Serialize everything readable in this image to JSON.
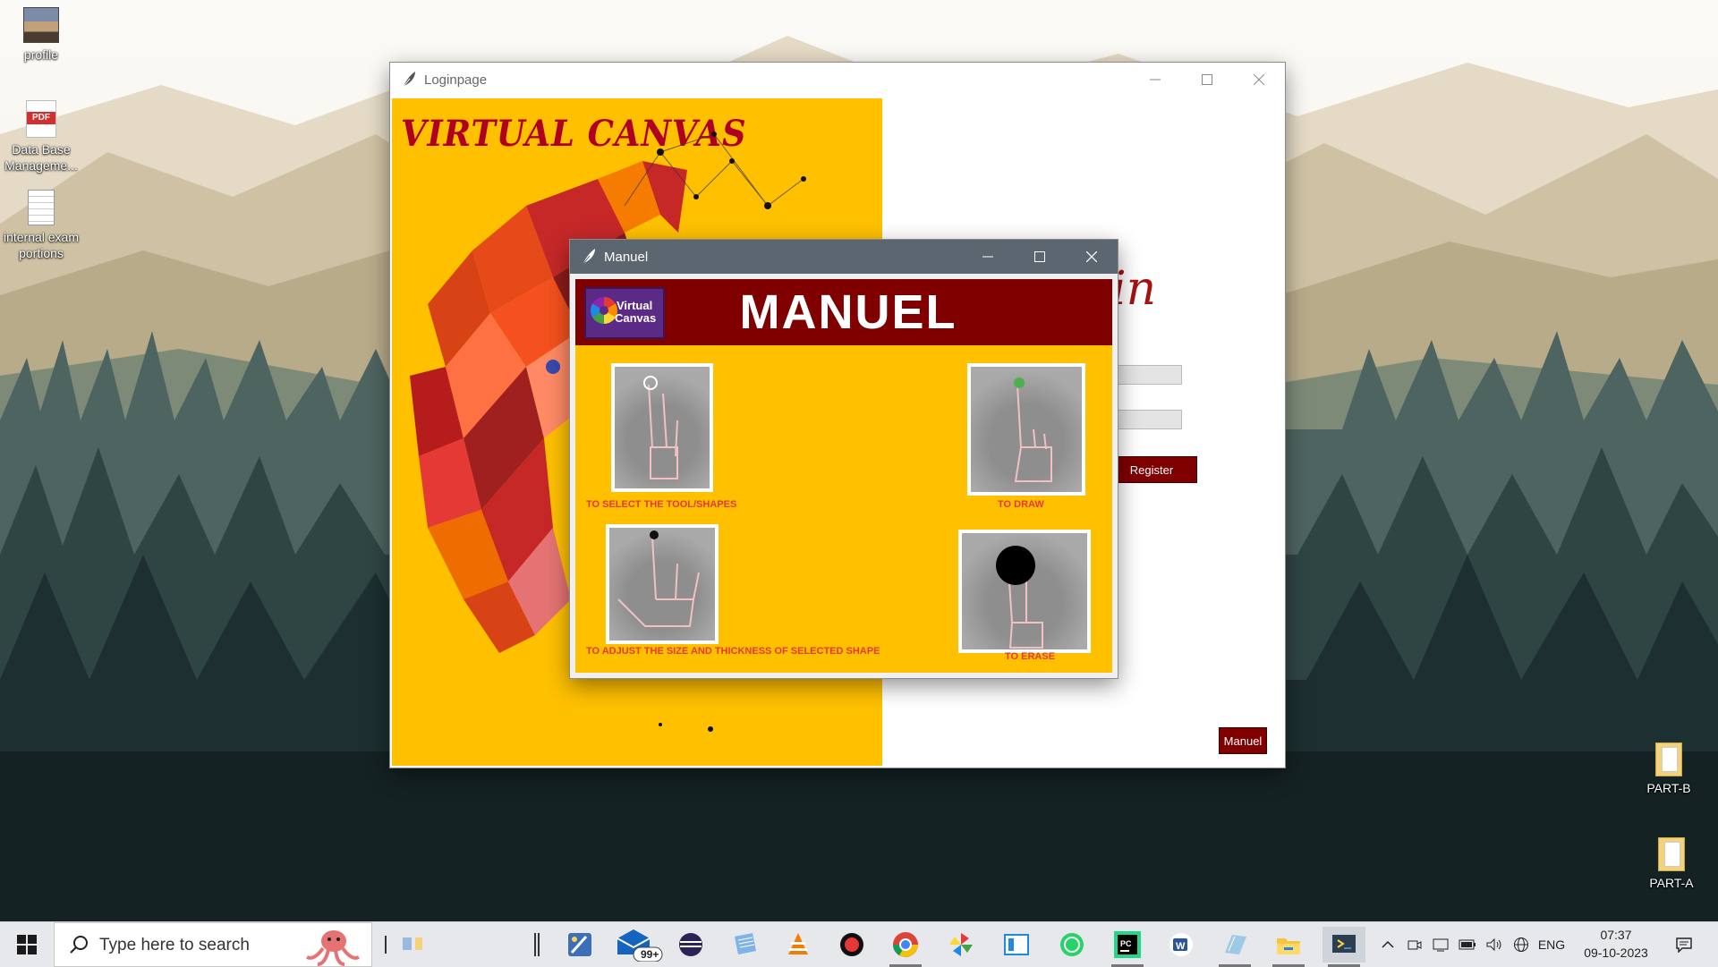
{
  "desktop": {
    "icons": [
      {
        "label": "profile"
      },
      {
        "label": "Data Base Manageme...",
        "badge": "PDF"
      },
      {
        "label": "internal exam portions"
      },
      {
        "label": "PART-B"
      },
      {
        "label": "PART-A"
      }
    ]
  },
  "login_window": {
    "title": "Loginpage",
    "brand": "VIRTUAL CANVAS",
    "heading_visible": "in",
    "register_label": "Register",
    "manuel_label": "Manuel"
  },
  "manuel_window": {
    "title": "Manuel",
    "header": "MANUEL",
    "logo_line1": "Virtual",
    "logo_line2": "Canvas",
    "gestures": [
      {
        "caption": "TO SELECT THE TOOL/SHAPES"
      },
      {
        "caption": "TO DRAW"
      },
      {
        "caption": "TO ADJUST THE SIZE AND THICKNESS OF SELECTED SHAPE"
      },
      {
        "caption": "TO ERASE"
      }
    ],
    "colors": {
      "header_bg": "#800000",
      "body_bg": "#ffc000",
      "caption": "#e53935"
    }
  },
  "taskbar": {
    "search_placeholder": "Type here to search",
    "mail_badge": "99+",
    "language": "ENG",
    "time": "07:37",
    "date": "09-10-2023",
    "apps": [
      "paint-app-icon",
      "mail-app-icon",
      "eclipse-app-icon",
      "notepad-app-icon",
      "vlc-app-icon",
      "record-app-icon",
      "chrome-app-icon",
      "pinwheel-app-icon",
      "screen-app-icon",
      "whatsapp-app-icon",
      "pycharm-app-icon",
      "word-app-icon",
      "notes-app-icon",
      "file-explorer-app-icon",
      "python-app-icon"
    ]
  }
}
